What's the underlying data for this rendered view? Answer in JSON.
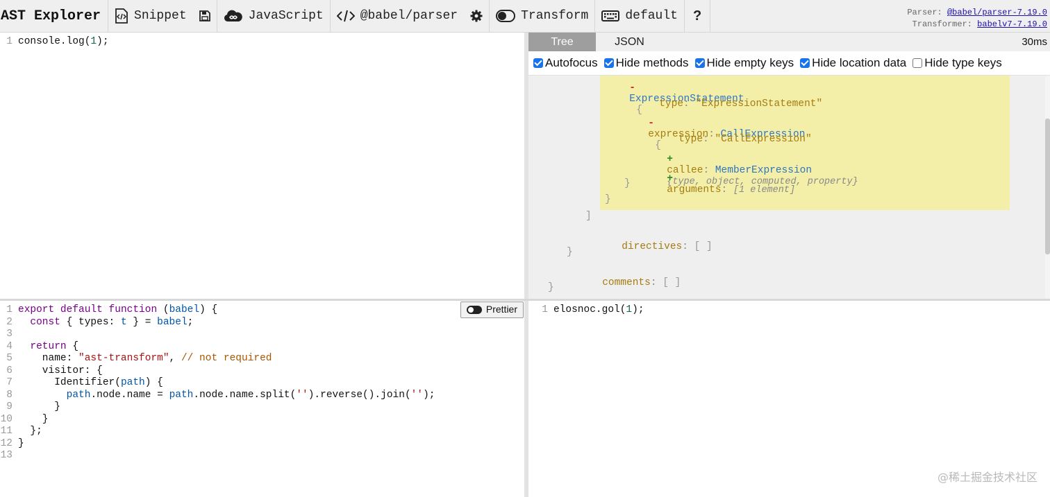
{
  "toolbar": {
    "brand": "AST Explorer",
    "snippet_label": "Snippet",
    "language_label": "JavaScript",
    "parser_label": "@babel/parser",
    "transform_label": "Transform",
    "keymap_label": "default",
    "help_label": "?",
    "parser_version_prefix": "Parser:",
    "parser_version_link": "@babel/parser-7.19.0",
    "transformer_version_prefix": "Transformer:",
    "transformer_version_link": "babelv7-7.19.0"
  },
  "code_editor": {
    "lines": [
      {
        "n": "1",
        "code": "console.log(1);"
      }
    ]
  },
  "ast": {
    "tabs": [
      "Tree",
      "JSON"
    ],
    "active_tab": "Tree",
    "parse_time": "30ms",
    "options": [
      {
        "label": "Autofocus",
        "checked": true
      },
      {
        "label": "Hide methods",
        "checked": true
      },
      {
        "label": "Hide empty keys",
        "checked": true
      },
      {
        "label": "Hide location data",
        "checked": true
      },
      {
        "label": "Hide type keys",
        "checked": false
      }
    ],
    "tree": {
      "expr_stmt_toggle": "-",
      "expr_stmt_type": "ExpressionStatement",
      "brace_open": "{",
      "type_key": "type",
      "expr_stmt_type_value": "\"ExpressionStatement\"",
      "expression_toggle": "-",
      "expression_key": "expression",
      "call_expr_type": "CallExpression",
      "call_type_value": "\"CallExpression\"",
      "callee_toggle": "+",
      "callee_key": "callee",
      "member_expr_type": "MemberExpression",
      "callee_summary": "{type, object, computed, property}",
      "arguments_toggle": "+",
      "arguments_key": "arguments",
      "arguments_summary": "[1 element]",
      "brace_close": "}",
      "bracket_close": "]",
      "directives_key": "directives",
      "empty_array": "[ ]",
      "comments_key": "comments"
    }
  },
  "transform_editor": {
    "prettier_label": "Prettier",
    "line_numbers": [
      "1",
      "2",
      "3",
      "4",
      "5",
      "6",
      "7",
      "8",
      "9",
      "10",
      "11",
      "12",
      "13"
    ]
  },
  "output_editor": {
    "lines": [
      {
        "n": "1",
        "code": "elosnoc.gol(1);"
      }
    ]
  },
  "watermark": "@稀土掘金技术社区"
}
